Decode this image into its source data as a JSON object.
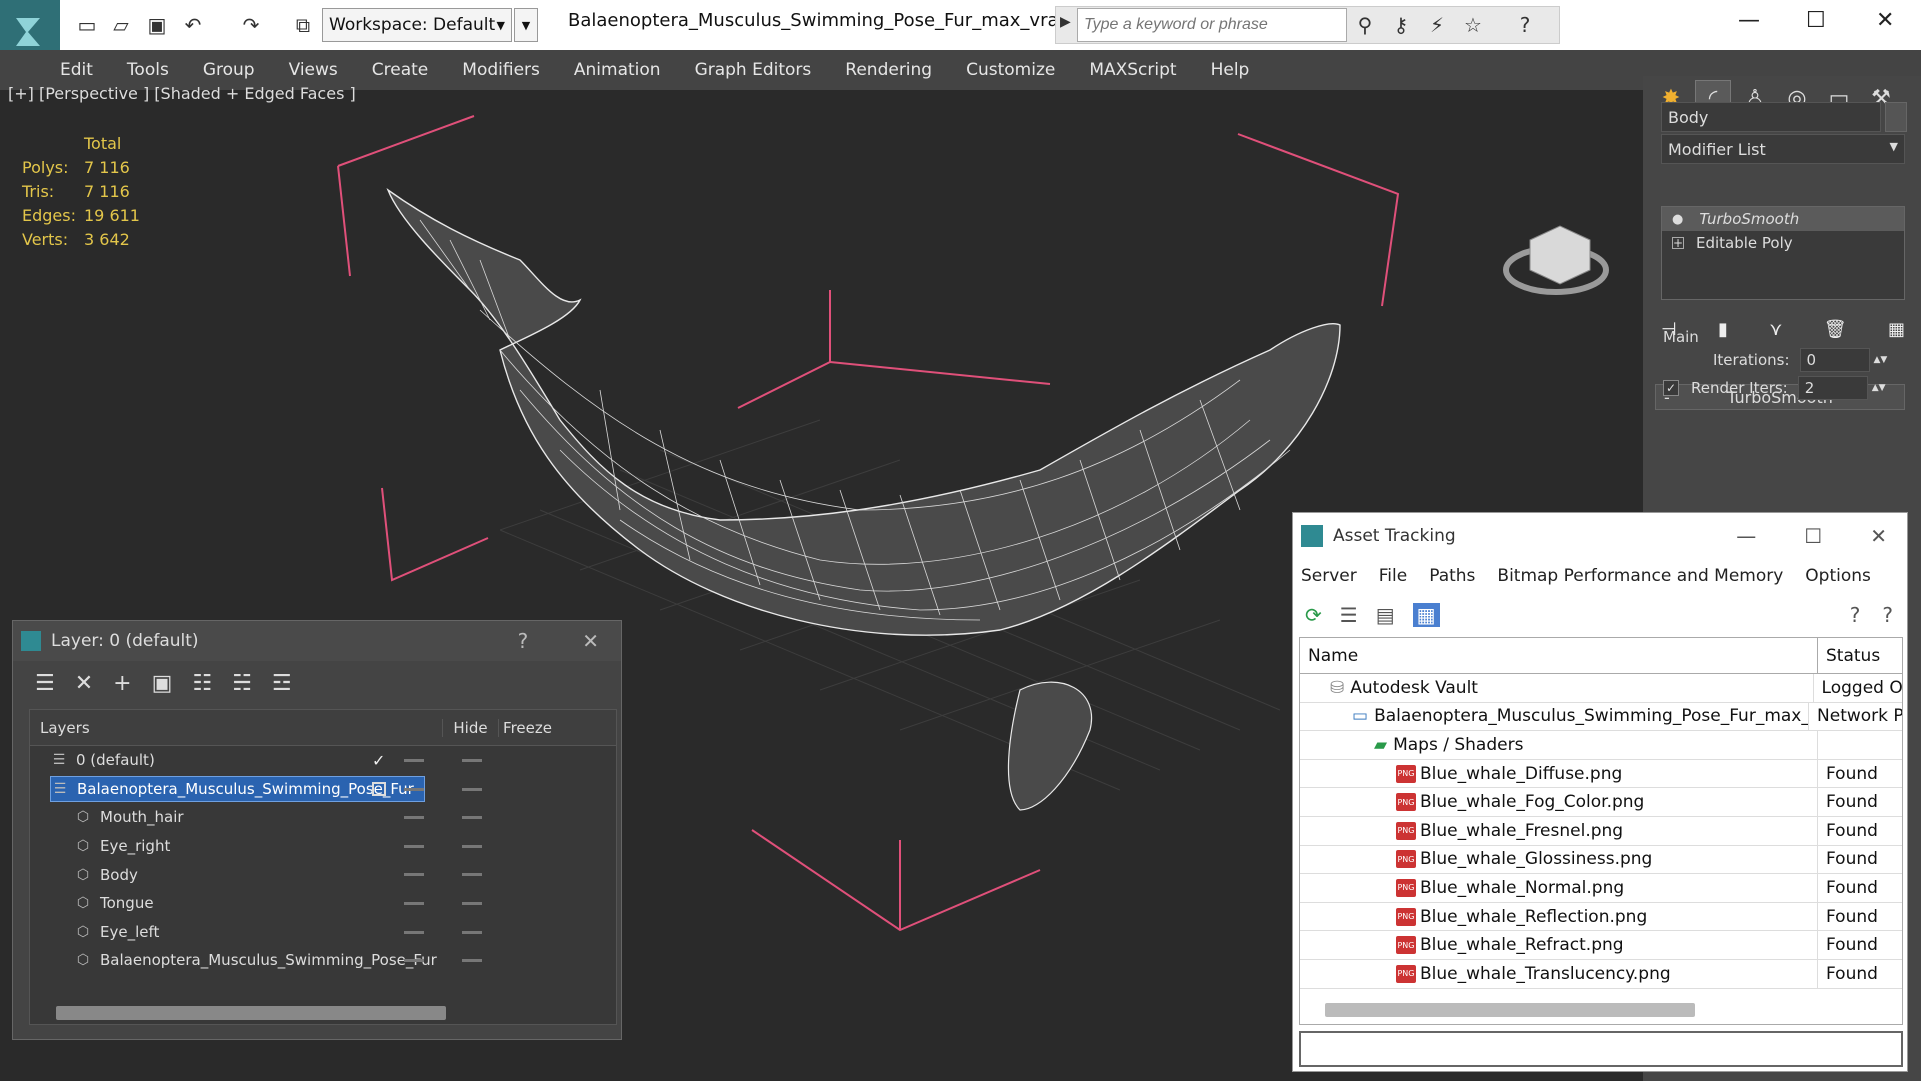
{
  "title_bar": {
    "workspace": "Workspace: Default",
    "document": "Balaenoptera_Musculus_Swimming_Pose_Fur_max_vray.max",
    "search_placeholder": "Type a keyword or phrase"
  },
  "menu": [
    "Edit",
    "Tools",
    "Group",
    "Views",
    "Create",
    "Modifiers",
    "Animation",
    "Graph Editors",
    "Rendering",
    "Customize",
    "MAXScript",
    "Help"
  ],
  "viewport": {
    "label": "[+] [Perspective ] [Shaded + Edged Faces ]",
    "stats_header": "Total",
    "stats": [
      {
        "k": "Polys:",
        "v": "7 116"
      },
      {
        "k": "Tris:",
        "v": "7 116"
      },
      {
        "k": "Edges:",
        "v": "19 611"
      },
      {
        "k": "Verts:",
        "v": "3 642"
      }
    ]
  },
  "command_panel": {
    "object_name": "Body",
    "modifier_list": "Modifier List",
    "stack": [
      "TurboSmooth",
      "Editable Poly"
    ],
    "rollout": "TurboSmooth",
    "group": "Main",
    "iterations_label": "Iterations:",
    "iterations_value": "0",
    "render_iters_label": "Render Iters:",
    "render_iters_value": "2"
  },
  "layer_window": {
    "title": "Layer: 0 (default)",
    "help": "?",
    "close": "✕",
    "col_layers": "Layers",
    "col_hide": "Hide",
    "col_freeze": "Freeze",
    "rows": [
      {
        "name": "0 (default)",
        "indent": 1,
        "type": "layer",
        "current": true
      },
      {
        "name": "Balaenoptera_Musculus_Swimming_Pose_Fur",
        "indent": 1,
        "type": "layer",
        "selected": true
      },
      {
        "name": "Mouth_hair",
        "indent": 2,
        "type": "object"
      },
      {
        "name": "Eye_right",
        "indent": 2,
        "type": "object"
      },
      {
        "name": "Body",
        "indent": 2,
        "type": "object"
      },
      {
        "name": "Tongue",
        "indent": 2,
        "type": "object"
      },
      {
        "name": "Eye_left",
        "indent": 2,
        "type": "object"
      },
      {
        "name": "Balaenoptera_Musculus_Swimming_Pose_Fur",
        "indent": 2,
        "type": "object"
      }
    ]
  },
  "asset_window": {
    "title": "Asset Tracking",
    "menu": [
      "Server",
      "File",
      "Paths",
      "Bitmap Performance and Memory",
      "Options"
    ],
    "col_name": "Name",
    "col_status": "Status",
    "rows": [
      {
        "name": "Autodesk Vault",
        "status": "Logged O",
        "indent": 1,
        "icon": "vault"
      },
      {
        "name": "Balaenoptera_Musculus_Swimming_Pose_Fur_max_vr...",
        "status": "Network P",
        "indent": 2,
        "icon": "max"
      },
      {
        "name": "Maps / Shaders",
        "status": "",
        "indent": 3,
        "icon": "maps"
      },
      {
        "name": "Blue_whale_Diffuse.png",
        "status": "Found",
        "indent": 4,
        "icon": "png"
      },
      {
        "name": "Blue_whale_Fog_Color.png",
        "status": "Found",
        "indent": 4,
        "icon": "png"
      },
      {
        "name": "Blue_whale_Fresnel.png",
        "status": "Found",
        "indent": 4,
        "icon": "png"
      },
      {
        "name": "Blue_whale_Glossiness.png",
        "status": "Found",
        "indent": 4,
        "icon": "png"
      },
      {
        "name": "Blue_whale_Normal.png",
        "status": "Found",
        "indent": 4,
        "icon": "png"
      },
      {
        "name": "Blue_whale_Reflection.png",
        "status": "Found",
        "indent": 4,
        "icon": "png"
      },
      {
        "name": "Blue_whale_Refract.png",
        "status": "Found",
        "indent": 4,
        "icon": "png"
      },
      {
        "name": "Blue_whale_Translucency.png",
        "status": "Found",
        "indent": 4,
        "icon": "png"
      }
    ]
  },
  "colors": {
    "accent": "#2a63b0",
    "selection_box": "#e0507a"
  }
}
